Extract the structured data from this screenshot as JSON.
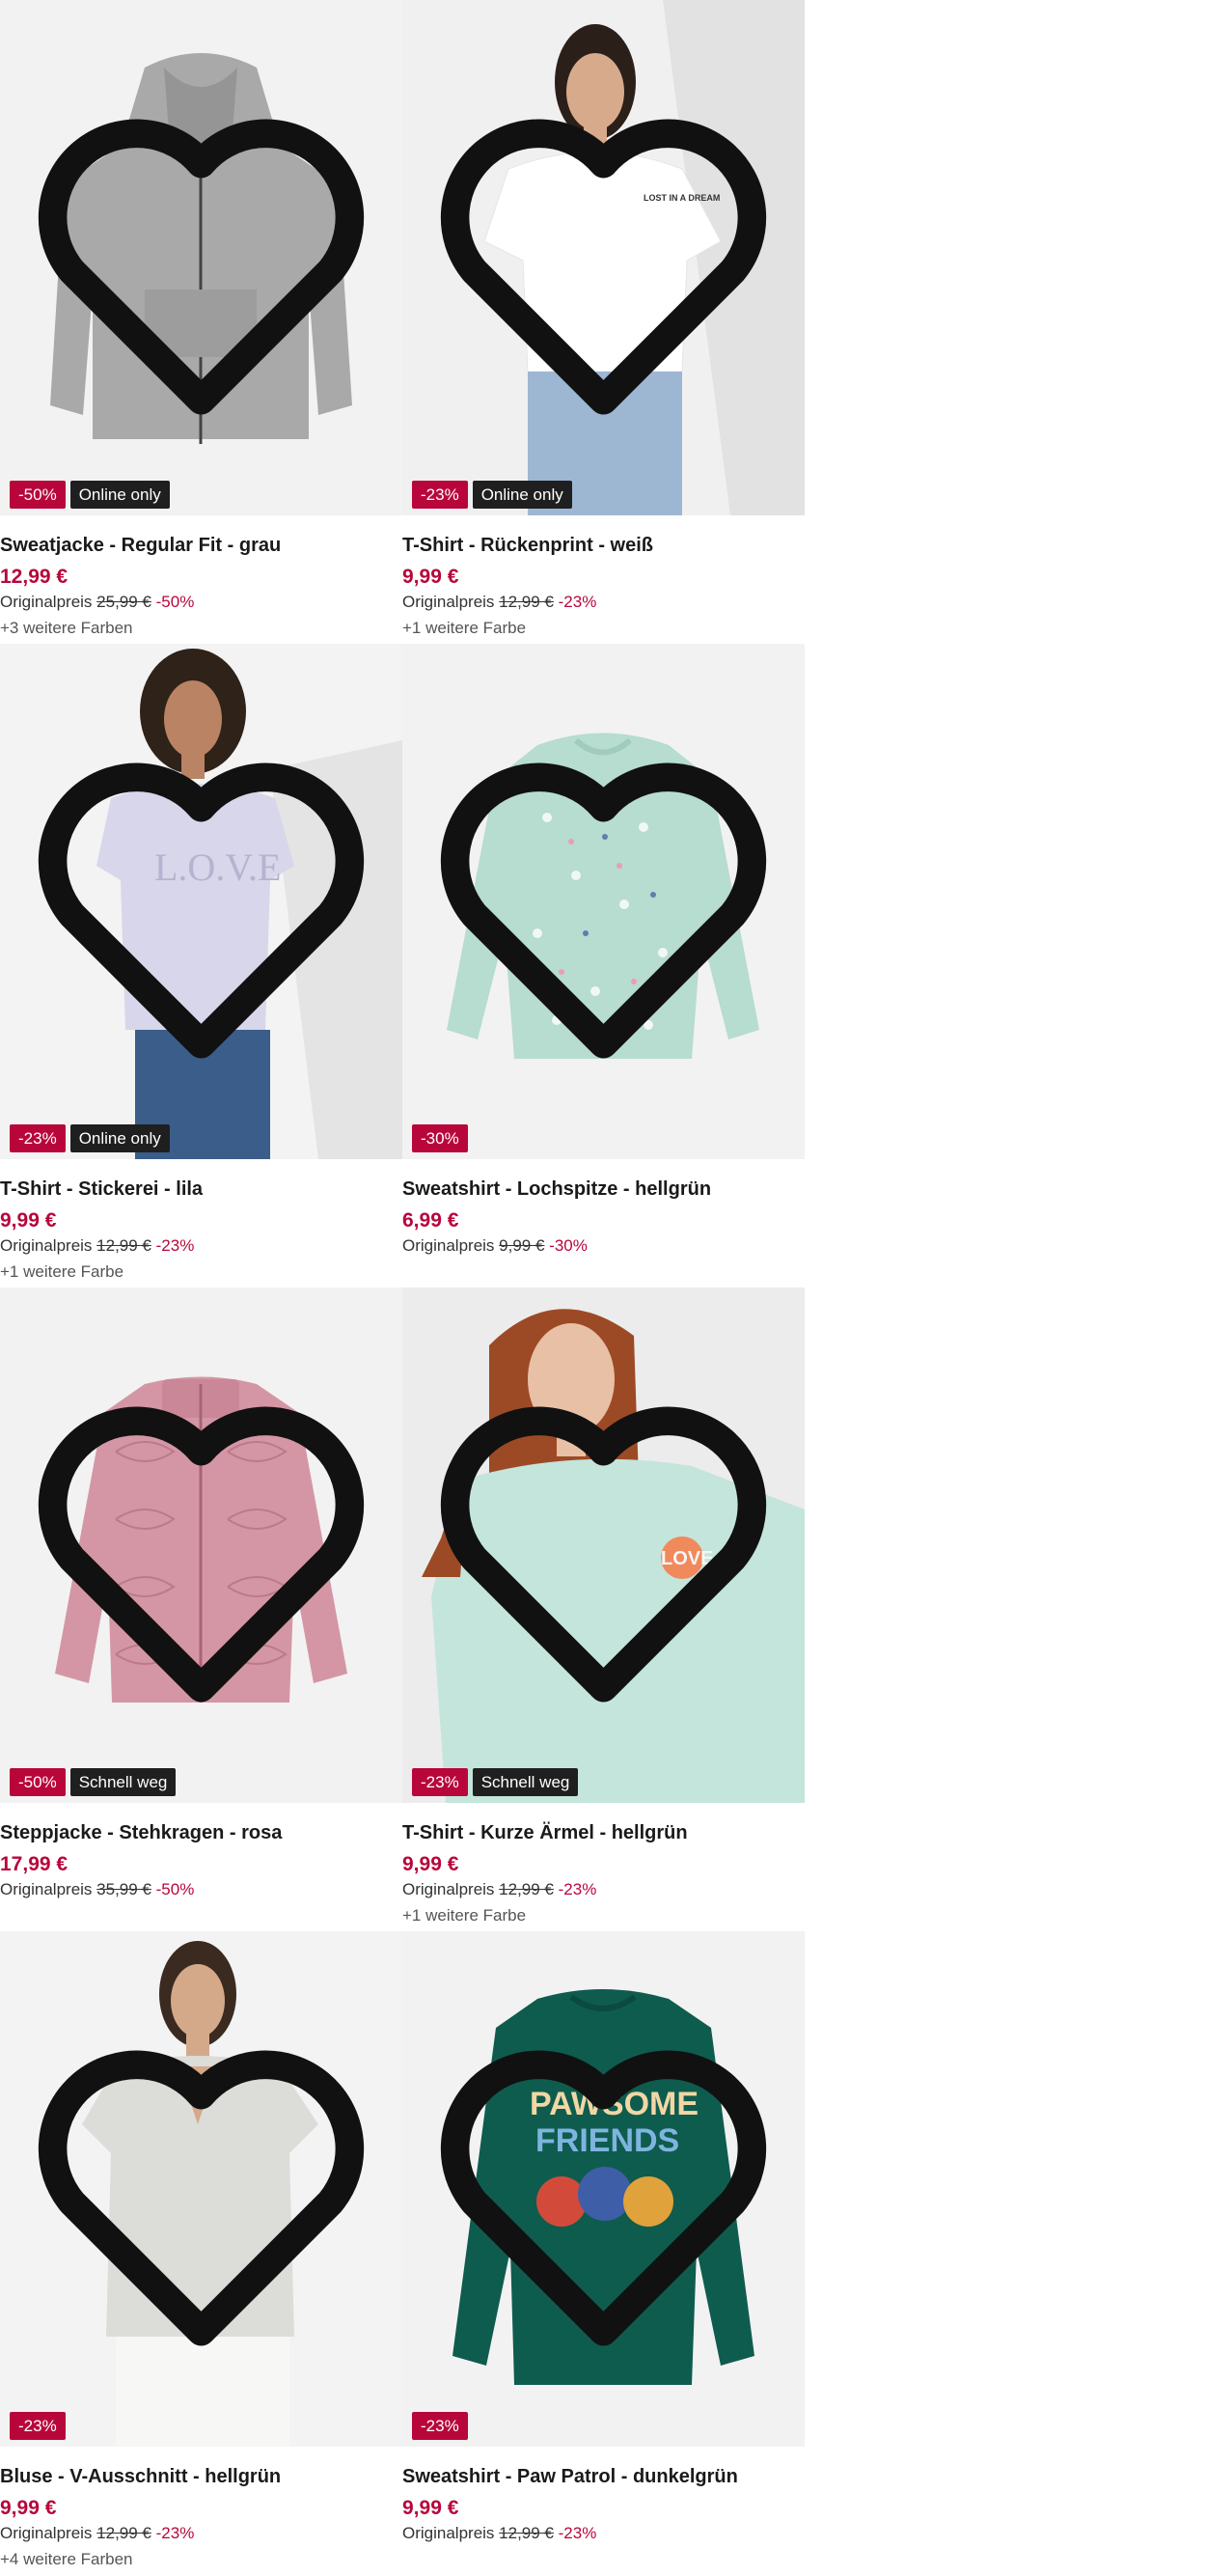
{
  "colors": {
    "accent": "#b8063b",
    "badge_dark": "#1f1f1f",
    "image_bg": "#f1f1f1"
  },
  "products": [
    {
      "title": "Sweatjacke - Regular Fit - grau",
      "price": "12,99 €",
      "orig_label": "Originalpreis",
      "orig_price": "25,99 €",
      "discount": "-50%",
      "badge": "-50%",
      "badge2": "Online only",
      "more_colors": "+3 weitere Farben"
    },
    {
      "title": "T-Shirt - Rückenprint - weiß",
      "price": "9,99 €",
      "orig_label": "Originalpreis",
      "orig_price": "12,99 €",
      "discount": "-23%",
      "badge": "-23%",
      "badge2": "Online only",
      "more_colors": "+1 weitere Farbe"
    },
    {
      "title": "T-Shirt - Stickerei - lila",
      "price": "9,99 €",
      "orig_label": "Originalpreis",
      "orig_price": "12,99 €",
      "discount": "-23%",
      "badge": "-23%",
      "badge2": "Online only",
      "more_colors": "+1 weitere Farbe"
    },
    {
      "title": "Sweatshirt - Lochspitze - hellgrün",
      "price": "6,99 €",
      "orig_label": "Originalpreis",
      "orig_price": "9,99 €",
      "discount": "-30%",
      "badge": "-30%",
      "badge2": "",
      "more_colors": ""
    },
    {
      "title": "Steppjacke - Stehkragen - rosa",
      "price": "17,99 €",
      "orig_label": "Originalpreis",
      "orig_price": "35,99 €",
      "discount": "-50%",
      "badge": "-50%",
      "badge2": "Schnell weg",
      "more_colors": ""
    },
    {
      "title": "T-Shirt - Kurze Ärmel - hellgrün",
      "price": "9,99 €",
      "orig_label": "Originalpreis",
      "orig_price": "12,99 €",
      "discount": "-23%",
      "badge": "-23%",
      "badge2": "Schnell weg",
      "more_colors": "+1 weitere Farbe"
    },
    {
      "title": "Bluse - V-Ausschnitt - hellgrün",
      "price": "9,99 €",
      "orig_label": "Originalpreis",
      "orig_price": "12,99 €",
      "discount": "-23%",
      "badge": "-23%",
      "badge2": "",
      "more_colors": "+4 weitere Farben"
    },
    {
      "title": "Sweatshirt - Paw Patrol - dunkelgrün",
      "price": "9,99 €",
      "orig_label": "Originalpreis",
      "orig_price": "12,99 €",
      "discount": "-23%",
      "badge": "-23%",
      "badge2": "",
      "more_colors": ""
    }
  ],
  "print_texts": {
    "tshirt_back": "LOST IN A DREAM",
    "tshirt_lila": "L.O.V.E",
    "tshirt_mint": "LOVE",
    "sweat_paw_1": "PAWSOME",
    "sweat_paw_2": "FRIENDS"
  }
}
